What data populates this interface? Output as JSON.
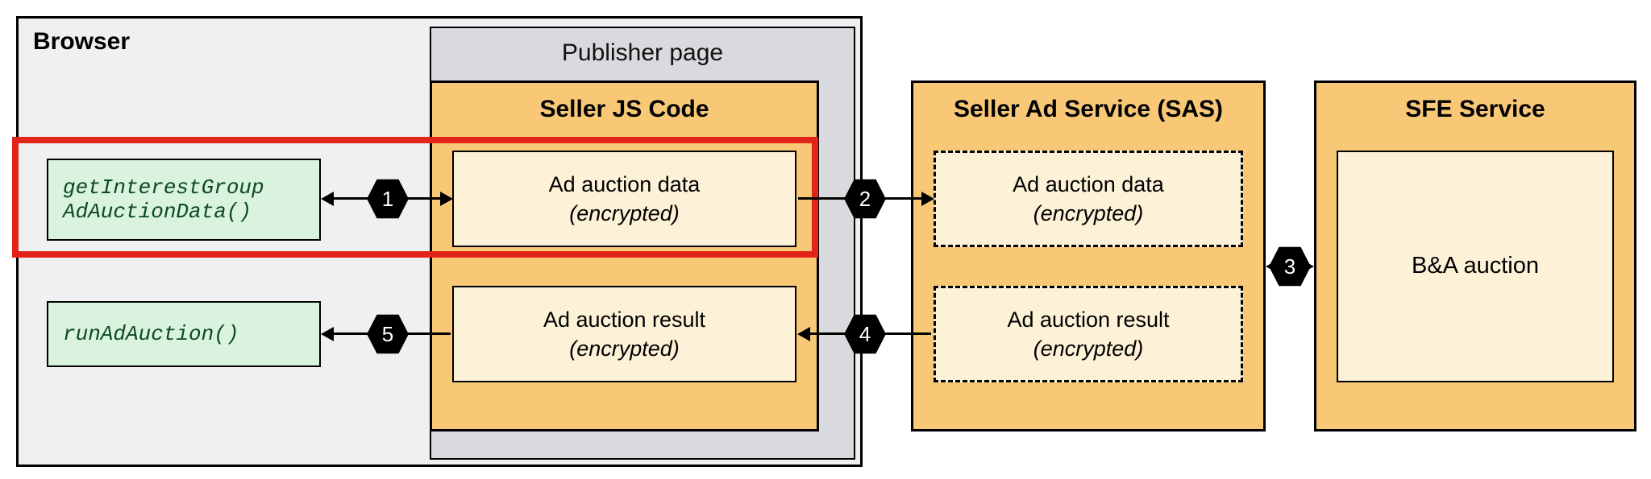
{
  "browser": {
    "label": "Browser"
  },
  "publisher": {
    "label": "Publisher page"
  },
  "seller_js": {
    "title": "Seller JS Code",
    "ad_data": {
      "line1": "Ad auction data",
      "line2": "(encrypted)"
    },
    "ad_result": {
      "line1": "Ad auction result",
      "line2": "(encrypted)"
    }
  },
  "sas": {
    "title": "Seller Ad Service (SAS)",
    "ad_data": {
      "line1": "Ad auction data",
      "line2": "(encrypted)"
    },
    "ad_result": {
      "line1": "Ad auction result",
      "line2": "(encrypted)"
    }
  },
  "sfe": {
    "title": "SFE Service",
    "content": "B&A auction"
  },
  "api": {
    "get_ig_line1": "getInterestGroup",
    "get_ig_line2": "AdAuctionData()",
    "run": "runAdAuction()"
  },
  "steps": {
    "s1": "1",
    "s2": "2",
    "s3": "3",
    "s4": "4",
    "s5": "5"
  }
}
